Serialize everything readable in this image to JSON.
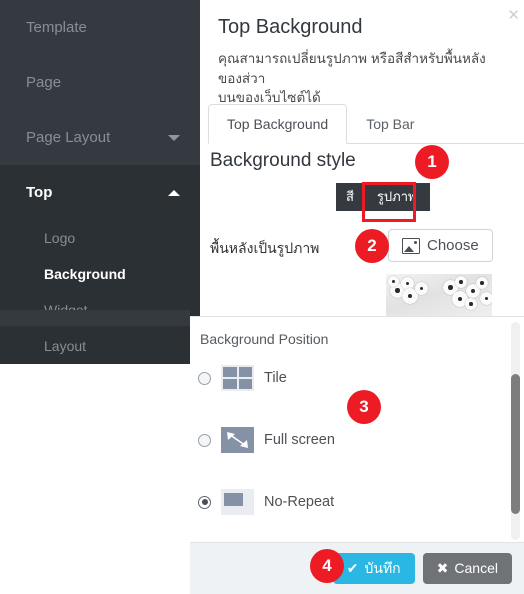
{
  "sidebar": {
    "items": [
      {
        "label": "Template",
        "state": "normal",
        "caret": "none"
      },
      {
        "label": "Page",
        "state": "normal",
        "caret": "none"
      },
      {
        "label": "Page Layout",
        "state": "normal",
        "caret": "down"
      },
      {
        "label": "Top",
        "state": "active-group",
        "caret": "up"
      }
    ],
    "sub_items": [
      {
        "label": "Logo",
        "active": false
      },
      {
        "label": "Background",
        "active": true
      },
      {
        "label": "Widget",
        "active": false
      },
      {
        "label": "Layout",
        "active": false
      }
    ]
  },
  "modal": {
    "title": "Top Background",
    "description": "คุณสามารถเปลี่ยนรูปภาพ หรือสีสำหรับพื้นหลังของส่วา\nบนของเว็บไซต์ได้",
    "close_icon": "close-icon",
    "tabs": [
      {
        "label": "Top Background",
        "active": true
      },
      {
        "label": "Top Bar",
        "active": false
      }
    ],
    "section_title": "Background style",
    "style_toggle": [
      {
        "label": "สี",
        "selected": false
      },
      {
        "label": "รูปภาพ",
        "selected": true
      }
    ],
    "image_field_label": "พื้นหลังเป็นรูปภาพ",
    "choose_button": {
      "label": "Choose",
      "icon": "image-icon"
    },
    "thumbnail_alt": "background-image-preview"
  },
  "position": {
    "title": "Background Position",
    "options": [
      {
        "label": "Tile",
        "icon": "tile-icon",
        "selected": false
      },
      {
        "label": "Full screen",
        "icon": "fullscreen-icon",
        "selected": false
      },
      {
        "label": "No-Repeat",
        "icon": "norepeat-icon",
        "selected": true
      }
    ]
  },
  "footer": {
    "save": {
      "label": "บันทึก",
      "icon": "check-icon"
    },
    "cancel": {
      "label": "Cancel",
      "icon": "x-icon"
    }
  },
  "annotations": [
    {
      "number": "1"
    },
    {
      "number": "2"
    },
    {
      "number": "3"
    },
    {
      "number": "4"
    }
  ],
  "colors": {
    "sidebar_bg": "#343a40",
    "sidebar_group_bg": "#2b3035",
    "accent_save": "#2ab7e4",
    "cancel_gray": "#6f7377",
    "annotation_red": "#ed1c24",
    "toggle_dark": "#343a40"
  }
}
